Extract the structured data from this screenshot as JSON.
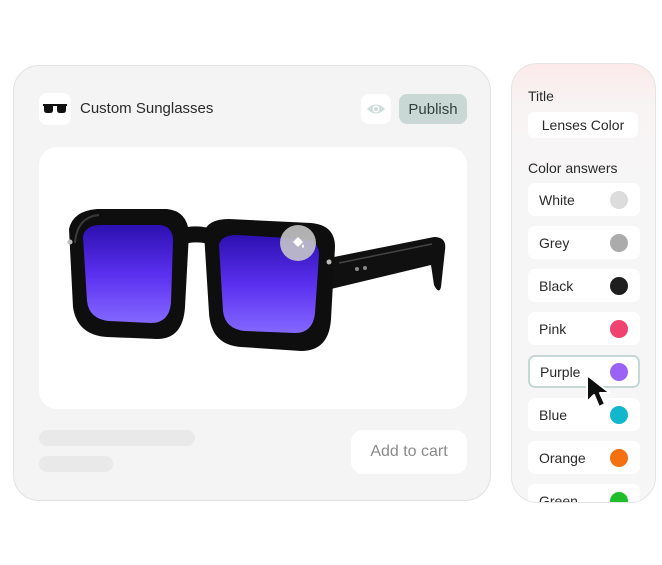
{
  "product": {
    "name": "Custom Sunglasses",
    "publish_label": "Publish",
    "add_to_cart_label": "Add to cart"
  },
  "icons": {
    "logo": "sunglasses-icon",
    "preview": "eye-icon",
    "hotspot": "paint-bucket-icon",
    "cursor": "mouse-pointer-icon"
  },
  "colors": {
    "lens": "#5b2ff2",
    "publish_bg": "#c9d8d5",
    "selected_border": "#c5d9d6"
  },
  "side_panel": {
    "title_label": "Title",
    "title_value": "Lenses Color",
    "answers_label": "Color answers",
    "answers": [
      {
        "label": "White",
        "color": "#dcdcdc"
      },
      {
        "label": "Grey",
        "color": "#ababab"
      },
      {
        "label": "Black",
        "color": "#1e1e1e"
      },
      {
        "label": "Pink",
        "color": "#f0426f"
      },
      {
        "label": "Purple",
        "color": "#9b63f3",
        "selected": true
      },
      {
        "label": "Blue",
        "color": "#12b7cc"
      },
      {
        "label": "Orange",
        "color": "#f5700f"
      },
      {
        "label": "Green",
        "color": "#1fbf2b"
      }
    ]
  }
}
